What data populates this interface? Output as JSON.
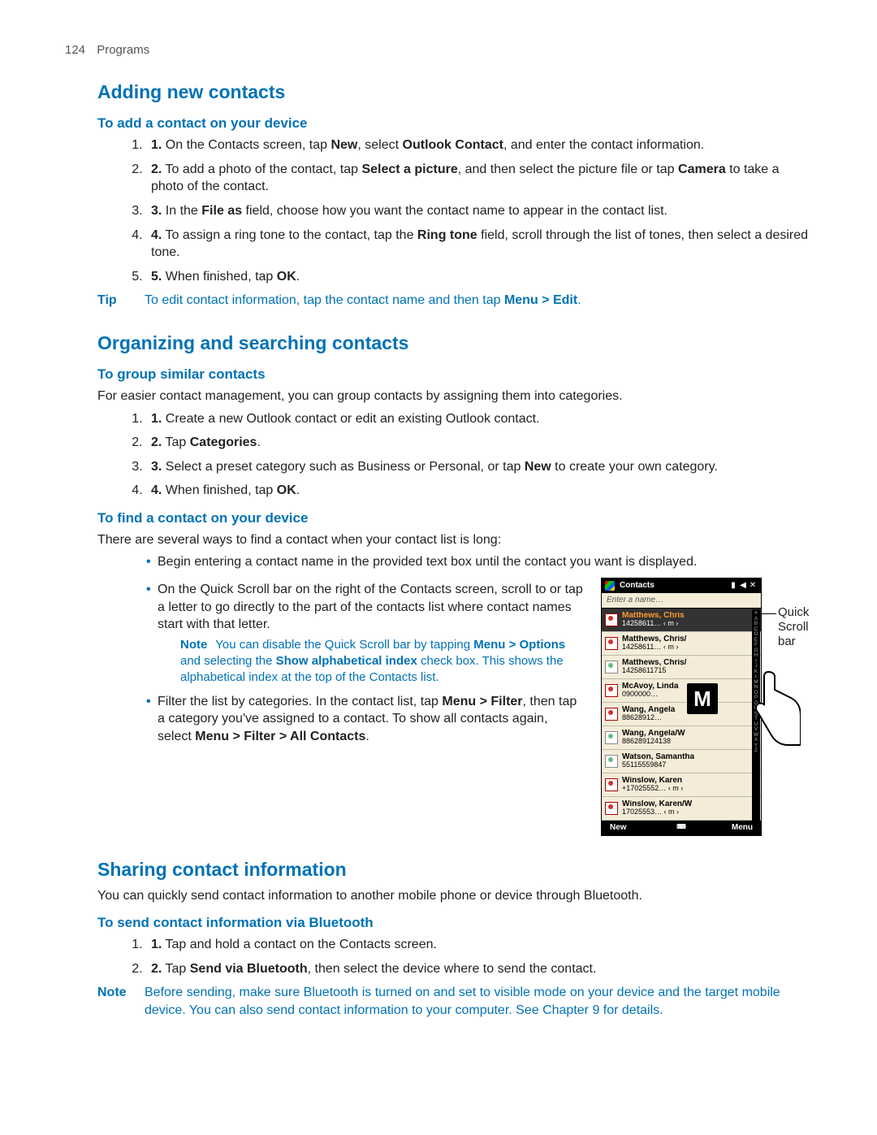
{
  "page_header": {
    "number": "124",
    "section": "Programs"
  },
  "sec1": {
    "title": "Adding new contacts",
    "sub1": "To add a contact on your device",
    "steps": [
      {
        "pre": "On the Contacts screen, tap ",
        "b1": "New",
        "mid1": ", select ",
        "b2": "Outlook Contact",
        "post": ", and enter the contact information."
      },
      {
        "pre": "To add a photo of the contact, tap ",
        "b1": "Select a picture",
        "mid1": ", and then select the picture file or tap ",
        "b2": "Camera",
        "post": " to take a photo of the contact."
      },
      {
        "pre": "In the ",
        "b1": "File as",
        "post": " field, choose how you want the contact name to appear in the contact list."
      },
      {
        "pre": "To assign a ring tone to the contact, tap the ",
        "b1": "Ring tone",
        "post": " field, scroll through the list of tones, then select a desired tone."
      },
      {
        "pre": "When finished, tap ",
        "b1": "OK",
        "post": "."
      }
    ],
    "tip_label": "Tip",
    "tip_pre": "To edit contact information, tap the contact name and then tap ",
    "tip_bold": "Menu > Edit",
    "tip_post": "."
  },
  "sec2": {
    "title": "Organizing and searching contacts",
    "sub1": "To group similar contacts",
    "intro1": "For easier contact management, you can group contacts by assigning them into categories.",
    "steps1": [
      {
        "text": "Create a new Outlook contact or edit an existing Outlook contact."
      },
      {
        "pre": "Tap ",
        "b1": "Categories",
        "post": "."
      },
      {
        "pre": "Select a preset category such as Business or Personal, or tap ",
        "b1": "New",
        "post": " to create your own category."
      },
      {
        "pre": "When finished, tap ",
        "b1": "OK",
        "post": "."
      }
    ],
    "sub2": "To find a contact on your device",
    "intro2": "There are several ways to find a contact when your contact list is long:",
    "bullet_first": "Begin entering a contact name in the provided text box until the contact you want is displayed.",
    "bullet2": "On the Quick Scroll bar on the right of the Contacts screen, scroll to or tap a letter to go directly to the part of the contacts list where contact names start with that letter.",
    "note_label": "Note",
    "note_pre": "You can disable the Quick Scroll bar by tapping ",
    "note_b1": "Menu > Options",
    "note_mid": " and selecting the ",
    "note_b2": "Show alphabetical index",
    "note_post": " check box. This shows the alphabetical index at the top of the Contacts list.",
    "bullet3_pre": "Filter the list by categories. In the contact list, tap ",
    "bullet3_b1": "Menu > Filter",
    "bullet3_mid": ", then tap a category you've assigned to a contact. To show all contacts again, select ",
    "bullet3_b2": "Menu > Filter > All Contacts",
    "bullet3_post": "."
  },
  "sec3": {
    "title": "Sharing contact information",
    "intro": "You can quickly send contact information to another mobile phone or device through Bluetooth.",
    "sub1": "To send contact information via Bluetooth",
    "steps": [
      {
        "text": "Tap and hold a contact on the Contacts screen."
      },
      {
        "pre": "Tap ",
        "b1": "Send via Bluetooth",
        "post": ", then select the device where to send the contact."
      }
    ],
    "note_label": "Note",
    "note_text": "Before sending, make sure Bluetooth is turned on and set to visible mode on your device and the target mobile device. You can also send contact information to your computer. See Chapter 9 for details."
  },
  "phone": {
    "title": "Contacts",
    "search_placeholder": "Enter a name…",
    "overlay_letter": "M",
    "soft_left": "New",
    "soft_right": "Menu",
    "rows": [
      {
        "name": "Matthews, Chris",
        "num": "14258611…   ‹  m ›",
        "sel": true
      },
      {
        "name": "Matthews, Chris/",
        "num": "14258611…   ‹  m ›"
      },
      {
        "name": "Matthews, Chris/",
        "num": "14258611715",
        "sim": true
      },
      {
        "name": "McAvoy, Linda",
        "num": "0900000…"
      },
      {
        "name": "Wang, Angela",
        "num": "88628912…"
      },
      {
        "name": "Wang, Angela/W",
        "num": "886289124138",
        "sim": true
      },
      {
        "name": "Watson, Samantha",
        "num": "55115559847",
        "sim": true
      },
      {
        "name": "Winslow, Karen",
        "num": "+17025552…   ‹  m ›"
      },
      {
        "name": "Winslow, Karen/W",
        "num": "17025553…   ‹  m ›"
      }
    ],
    "alpha": [
      "#",
      "A",
      "B",
      "C",
      "D",
      "E",
      "F",
      "G",
      "H",
      "I",
      "J",
      "K",
      "L",
      "M",
      "N",
      "O",
      "P",
      "Q",
      "R",
      "S",
      "T",
      "U",
      "V",
      "W",
      "X",
      "Y",
      "Z"
    ],
    "label": "Quick Scroll bar"
  }
}
